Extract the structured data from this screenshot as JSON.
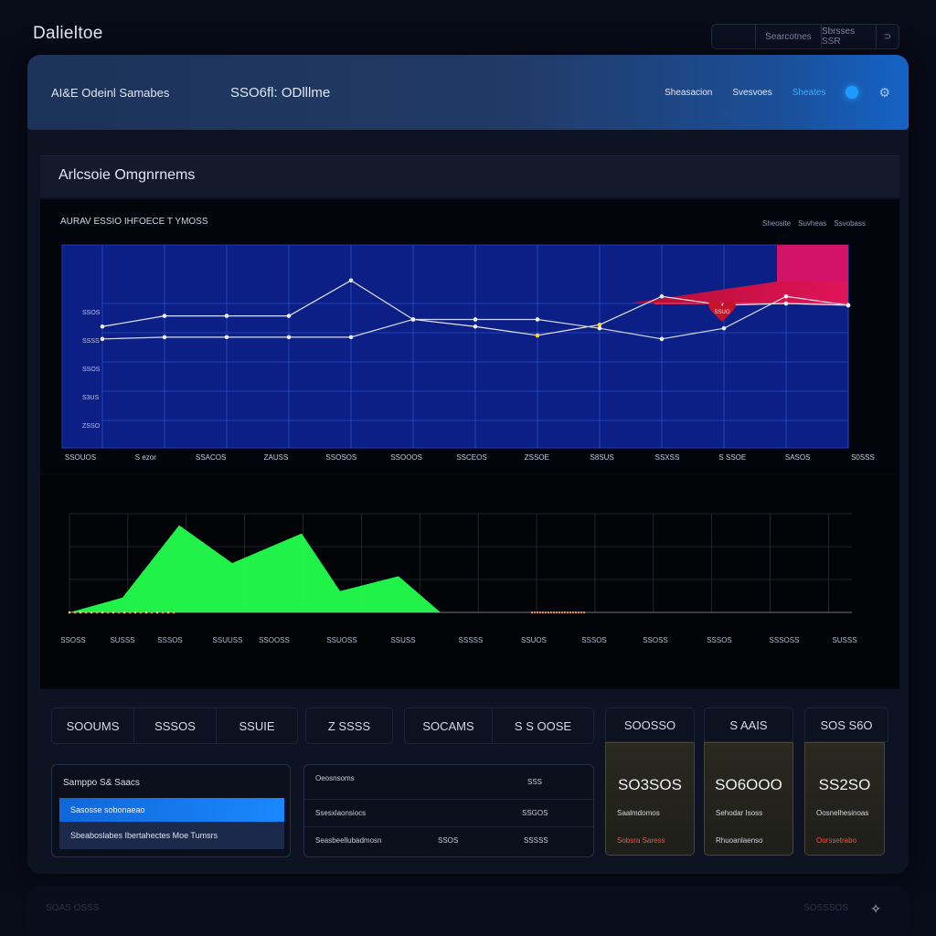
{
  "app": {
    "title": "Dalieltoe"
  },
  "top_controls": {
    "items": [
      "",
      "Searcotnes",
      "Sbrsses SSR",
      "⊃"
    ]
  },
  "header": {
    "workspace": "AI&E Odeinl Samabes",
    "subtitle": "SSO6fl: ODlllme",
    "nav": [
      "Sheasacion",
      "Svesvoes",
      "Sheates"
    ],
    "active_index": 2,
    "icon": "settings-icon"
  },
  "section": {
    "title": "Arlcsoie Omgnrnems"
  },
  "chart_data": [
    {
      "type": "line",
      "title": "AURAV ESSIO IHFOECE T YMOSS",
      "legend": [
        "Sheosite",
        "Suvheas",
        "Ssvobass"
      ],
      "categories": [
        "SSOUOS",
        "S ezor",
        "SSACOS",
        "ZAUSS",
        "SSOSOS",
        "SSOOOS",
        "SSCEOS",
        "ZSSOE",
        "S8SUS",
        "SSXSS",
        "S SSOE",
        "SASOS",
        "S0SSS"
      ],
      "y_tick_labels": [
        "SSOS",
        "SSSS",
        "SSOS",
        "S3US",
        "ZSSO"
      ],
      "ylim": [
        0,
        100
      ],
      "series": [
        {
          "color": "#e8e8f0",
          "values": [
            54,
            60,
            60,
            60,
            80,
            58,
            54,
            49,
            55,
            71,
            66,
            67,
            66
          ]
        },
        {
          "color": "#d8dce8",
          "values": [
            47,
            48,
            48,
            48,
            48,
            58,
            58,
            58,
            53,
            47,
            53,
            71,
            66
          ]
        }
      ],
      "annotation": "SSUO",
      "highlight_color": "#e0145a"
    },
    {
      "type": "area",
      "categories": [
        "SSOSS",
        "SUSSS",
        "SSSOS",
        "SSUUSS",
        "SSOOSS",
        "SSUOSS",
        "SSUSS",
        "SSSSS",
        "SSUOS",
        "SSSOS",
        "SSOSS",
        "SSSOS",
        "SSSOSS",
        "SUSSS"
      ],
      "series": [
        {
          "color": "#23ff4d",
          "values": [
            0,
            9,
            53,
            30,
            48,
            13,
            22,
            0,
            0,
            0,
            0,
            0,
            0,
            0
          ]
        }
      ]
    }
  ],
  "kpi_rows": [
    {
      "cells": [
        "SOOUMS",
        "SSSOS",
        "SSUIE"
      ]
    },
    {
      "cells": [
        "Z SSSS"
      ]
    },
    {
      "cells": [
        "SOCAMS",
        "S S OOSE"
      ]
    }
  ],
  "stat_cards": [
    {
      "head": "SOOSSO",
      "value": "SO3SOS",
      "label": "Saalmdomos",
      "footer": "Sobsra Saress",
      "footer_color": "#e05a4a"
    },
    {
      "head": "S AAIS",
      "value": "SO6OOO",
      "label": "Sehodar Isoss",
      "footer": "Rhuoanlaenso",
      "footer_color": "#cfd3dc"
    },
    {
      "head": "SOS S6O",
      "value": "SS2SO",
      "label": "Oosnelhesinoas",
      "footer": "Oorssetrabo",
      "footer_color": "#ff4a3a"
    }
  ],
  "list": {
    "title": "Samppo S& Saacs",
    "rows": [
      "Sasosse sobonaeao",
      "Sbeaboslabes Ibertahectes Moe Tumsrs"
    ]
  },
  "table": {
    "header": [
      "Oeosnsoms",
      "SSS"
    ],
    "rows": [
      [
        "Ssesxlaonsiocs",
        "",
        "SSGOS"
      ],
      [
        "Seasbeellubadmosn",
        "SSOS",
        "SSSSS"
      ]
    ]
  },
  "footer": {
    "left": "SOAS OSSS",
    "right": "SOSSSOS",
    "icon": "sparkle-icon"
  }
}
